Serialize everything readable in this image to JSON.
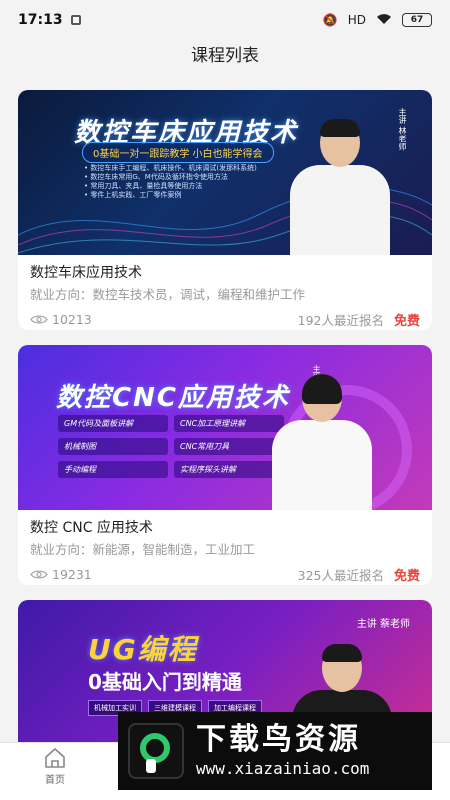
{
  "status": {
    "time": "17:13",
    "battery": "67",
    "network": "HD"
  },
  "page": {
    "title": "课程列表"
  },
  "courses": [
    {
      "banner": {
        "title": "数控车床应用技术",
        "subtitle": "0基础一对一跟踪教学 小白也能学得会",
        "instructor": "主讲 林老师",
        "points": [
          "• 数控车床手工编程、机床操作、机床调试(发那科系统)",
          "• 数控车床常用G、M代码及循环指令使用方法",
          "• 常用刀具、夹具、量检具等使用方法",
          "• 零件上机实践、工厂零件案例"
        ]
      },
      "title": "数控车床应用技术",
      "direction": "就业方向：数控车技术员，调试，编程和维护工作",
      "views": "10213",
      "enrolled": "192人最近报名",
      "price": "免费"
    },
    {
      "banner": {
        "title": "数控CNC应用技术",
        "instructor": "主讲 马老师",
        "tags": [
          "GM代码及面板讲解",
          "CNC加工原理讲解",
          "机械制图",
          "CNC常用刀具",
          "手动编程",
          "实程序探头讲解"
        ]
      },
      "title": "数控 CNC 应用技术",
      "direction": "就业方向：新能源，智能制造，工业加工",
      "views": "19231",
      "enrolled": "325人最近报名",
      "price": "免费"
    },
    {
      "banner": {
        "title": "UG编程",
        "subtitle": "0基础入门到精通",
        "instructor": "主讲 蔡老师",
        "chips": [
          "机械加工实训",
          "三维建模课程",
          "加工编程课程"
        ]
      }
    }
  ],
  "tabbar": {
    "home_label": "首页"
  },
  "watermark": {
    "title": "下载鸟资源",
    "url": "www.xiazainiao.com"
  },
  "colors": {
    "price": "#e8443c",
    "muted": "#999999",
    "background": "#f3f3f3"
  }
}
